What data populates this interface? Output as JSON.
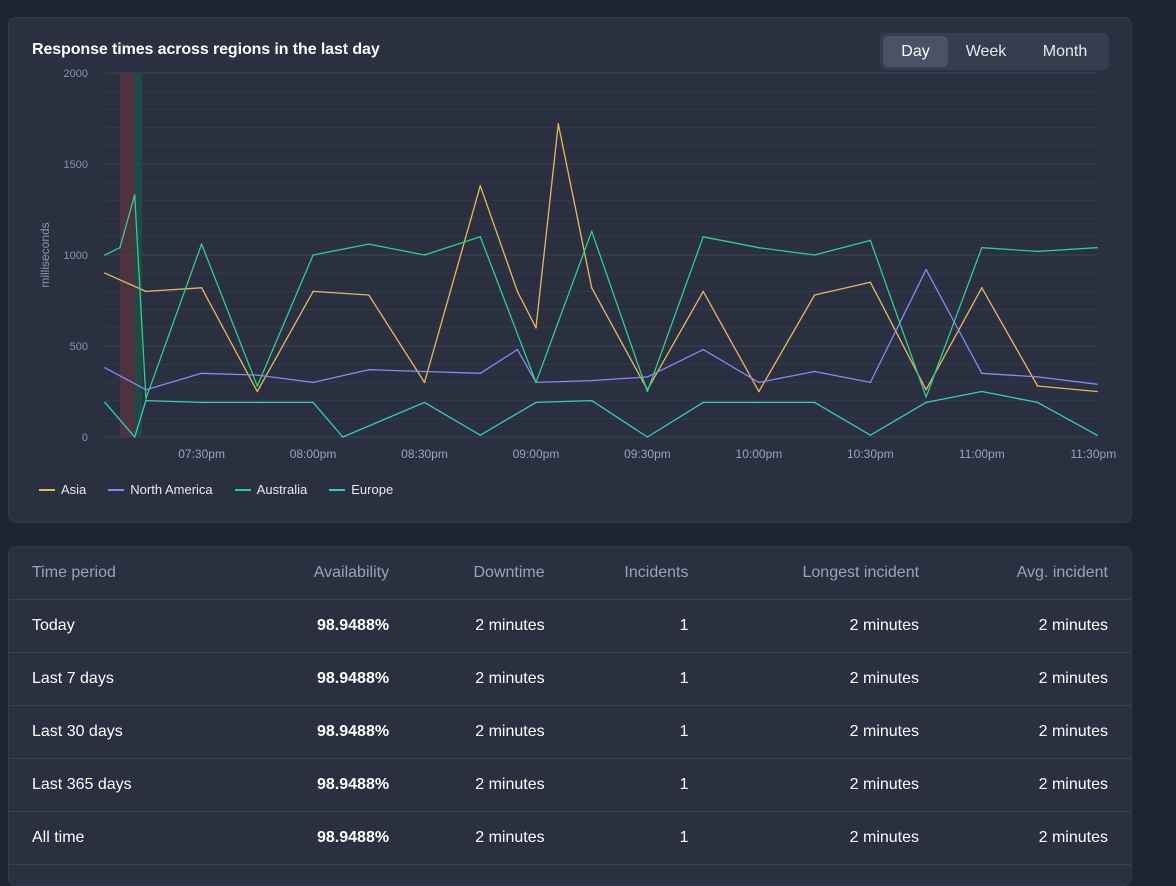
{
  "chart": {
    "title": "Response times across regions in the last day",
    "range_buttons": [
      "Day",
      "Week",
      "Month"
    ],
    "active_range": "Day"
  },
  "chart_data": {
    "type": "line",
    "ylabel": "milliseconds",
    "ylim": [
      0,
      2000
    ],
    "y_ticks": [
      0,
      500,
      1000,
      1500,
      2000
    ],
    "x_tick_labels": [
      "07:30pm",
      "08:00pm",
      "08:30pm",
      "09:00pm",
      "09:30pm",
      "10:00pm",
      "10:30pm",
      "11:00pm",
      "11:30pm"
    ],
    "x_start": "07:04pm",
    "x_end": "11:31pm",
    "grid": true,
    "legend_position": "bottom-left",
    "incident_bands": [
      {
        "start": "07:08pm",
        "end": "07:12pm",
        "color": "#5a3440"
      },
      {
        "start": "07:12pm",
        "end": "07:14pm",
        "color": "#1e5046"
      }
    ],
    "series": [
      {
        "name": "Asia",
        "color": "#e6b85f",
        "x": [
          "07:04pm",
          "07:15pm",
          "07:30pm",
          "07:45pm",
          "08:00pm",
          "08:15pm",
          "08:30pm",
          "08:45pm",
          "08:55pm",
          "09:00pm",
          "09:06pm",
          "09:15pm",
          "09:30pm",
          "09:45pm",
          "10:00pm",
          "10:15pm",
          "10:30pm",
          "10:45pm",
          "11:00pm",
          "11:15pm",
          "11:31pm"
        ],
        "values": [
          900,
          800,
          820,
          250,
          800,
          780,
          300,
          1380,
          800,
          600,
          1720,
          820,
          260,
          800,
          250,
          780,
          850,
          260,
          820,
          280,
          250
        ]
      },
      {
        "name": "North America",
        "color": "#8b86f0",
        "x": [
          "07:04pm",
          "07:15pm",
          "07:30pm",
          "07:45pm",
          "08:00pm",
          "08:15pm",
          "08:30pm",
          "08:45pm",
          "08:55pm",
          "09:00pm",
          "09:15pm",
          "09:30pm",
          "09:45pm",
          "10:00pm",
          "10:15pm",
          "10:30pm",
          "10:45pm",
          "11:00pm",
          "11:15pm",
          "11:31pm"
        ],
        "values": [
          380,
          260,
          350,
          340,
          300,
          370,
          360,
          350,
          480,
          300,
          310,
          330,
          480,
          300,
          360,
          300,
          920,
          350,
          330,
          290
        ]
      },
      {
        "name": "Australia",
        "color": "#2ecf8d",
        "x": [
          "07:04pm",
          "07:08pm",
          "07:12pm",
          "07:15pm",
          "07:30pm",
          "07:45pm",
          "08:00pm",
          "08:15pm",
          "08:30pm",
          "08:45pm",
          "09:00pm",
          "09:15pm",
          "09:30pm",
          "09:45pm",
          "10:00pm",
          "10:15pm",
          "10:30pm",
          "10:45pm",
          "11:00pm",
          "11:15pm",
          "11:31pm"
        ],
        "values": [
          1000,
          1040,
          1330,
          210,
          1060,
          280,
          1000,
          1060,
          1000,
          1100,
          300,
          1130,
          250,
          1100,
          1040,
          1000,
          1080,
          220,
          1040,
          1020,
          1040
        ]
      },
      {
        "name": "Europe",
        "color": "#2fd0c0",
        "x": [
          "07:04pm",
          "07:12pm",
          "07:15pm",
          "07:30pm",
          "07:45pm",
          "08:00pm",
          "08:08pm",
          "08:30pm",
          "08:45pm",
          "09:00pm",
          "09:15pm",
          "09:30pm",
          "09:45pm",
          "10:00pm",
          "10:15pm",
          "10:30pm",
          "10:45pm",
          "11:00pm",
          "11:15pm",
          "11:31pm"
        ],
        "values": [
          190,
          0,
          200,
          190,
          190,
          190,
          0,
          190,
          10,
          190,
          200,
          0,
          190,
          190,
          190,
          10,
          190,
          250,
          190,
          10
        ]
      }
    ]
  },
  "table": {
    "headers": [
      "Time period",
      "Availability",
      "Downtime",
      "Incidents",
      "Longest incident",
      "Avg. incident"
    ],
    "rows": [
      [
        "Today",
        "98.9488%",
        "2 minutes",
        "1",
        "2 minutes",
        "2 minutes"
      ],
      [
        "Last 7 days",
        "98.9488%",
        "2 minutes",
        "1",
        "2 minutes",
        "2 minutes"
      ],
      [
        "Last 30 days",
        "98.9488%",
        "2 minutes",
        "1",
        "2 minutes",
        "2 minutes"
      ],
      [
        "Last 365 days",
        "98.9488%",
        "2 minutes",
        "1",
        "2 minutes",
        "2 minutes"
      ],
      [
        "All time",
        "98.9488%",
        "2 minutes",
        "1",
        "2 minutes",
        "2 minutes"
      ]
    ]
  }
}
